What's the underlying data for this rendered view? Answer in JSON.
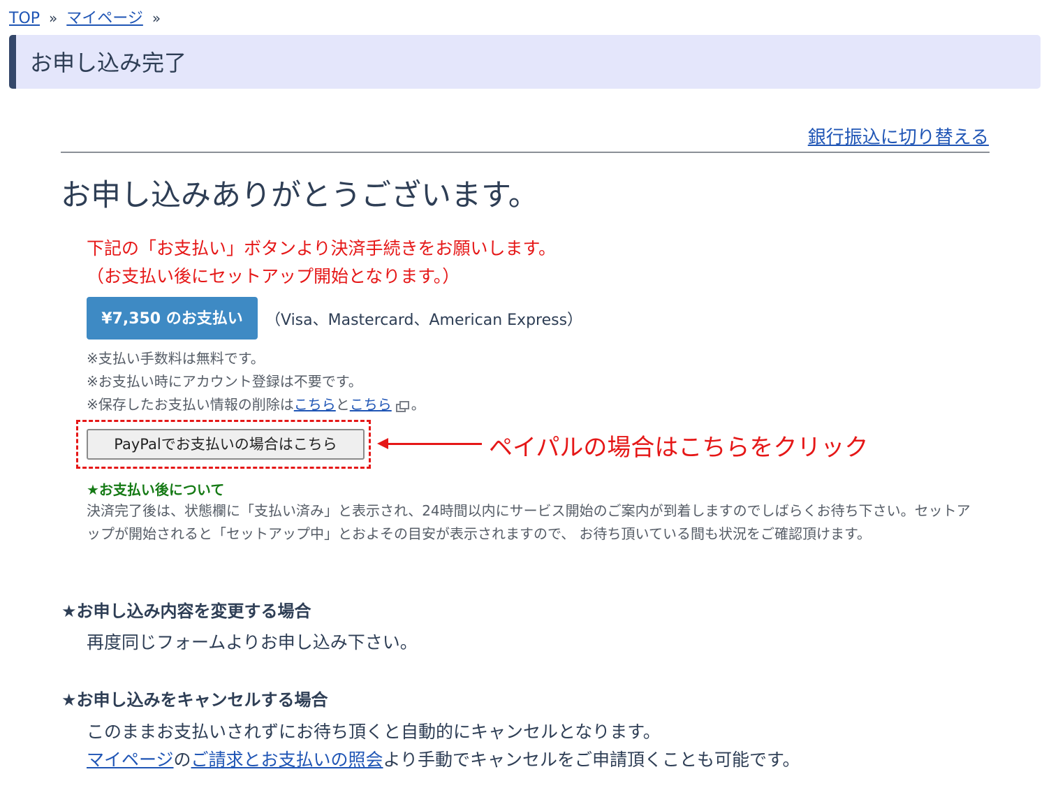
{
  "breadcrumb": {
    "top": "TOP",
    "mypage": "マイページ",
    "sep": "»"
  },
  "header": {
    "title": "お申し込み完了"
  },
  "switch_link": "銀行振込に切り替える",
  "thanks": "お申し込みありがとうございます。",
  "notice": {
    "line1": "下記の「お支払い」ボタンより決済手続きをお願いします。",
    "line2": "（お支払い後にセットアップ開始となります。）"
  },
  "payment": {
    "button_label": "¥7,350 のお支払い",
    "cards": "（Visa、Mastercard、American Express）"
  },
  "notes": {
    "fee": "※支払い手数料は無料です。",
    "account": "※お支払い時にアカウント登録は不要です。",
    "delete_prefix": "※保存したお支払い情報の削除は",
    "link1": "こちら",
    "and": "と",
    "link2": "こちら",
    "suffix": "。"
  },
  "paypal": {
    "button_label": "PayPalでお支払いの場合はこちら"
  },
  "callout": "ペイパルの場合はこちらをクリック",
  "after_payment": {
    "title": "★お支払い後について",
    "body": "決済完了後は、状態欄に「支払い済み」と表示され、24時間以内にサービス開始のご案内が到着しますのでしばらくお待ち下さい。セットアップが開始されると「セットアップ中」とおよその目安が表示されますので、 お待ち頂いている間も状況をご確認頂けます。"
  },
  "change_section": {
    "title": "★お申し込み内容を変更する場合",
    "body": "再度同じフォームよりお申し込み下さい。"
  },
  "cancel_section": {
    "title": "★お申し込みをキャンセルする場合",
    "line1": "このままお支払いされずにお待ち頂くと自動的にキャンセルとなります。",
    "link_mypage": "マイページ",
    "no": "の",
    "link_billing": "ご請求とお支払いの照会",
    "line2_suffix": "より手動でキャンセルをご申請頂くことも可能です。"
  },
  "colors": {
    "accent_red": "#e51717",
    "pay_button": "#3e8ac4",
    "header_bg": "#e4e6fb",
    "header_bar": "#34476a",
    "link": "#1f55b5",
    "green": "#157a15"
  }
}
